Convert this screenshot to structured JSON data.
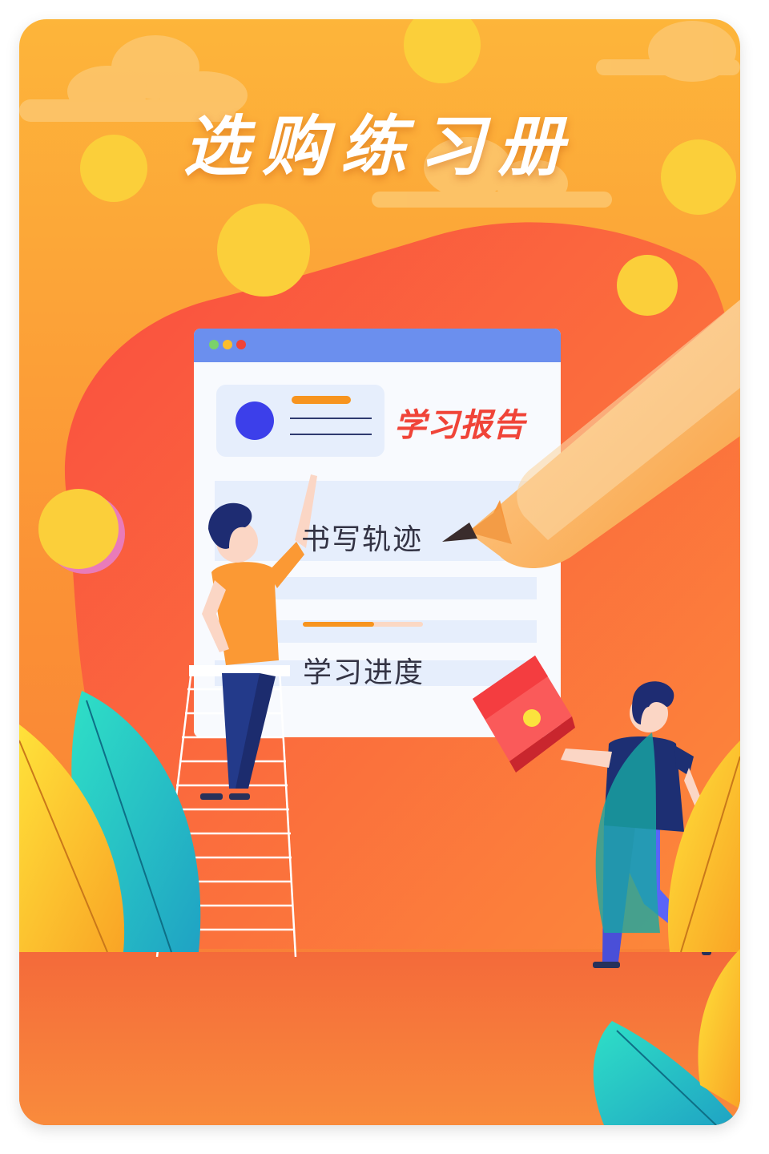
{
  "title": "选购练习册",
  "screen": {
    "report_label": "学习报告",
    "row1_text": "书写轨迹",
    "row2_text": "学习进度",
    "progress_fraction": 0.59
  },
  "colors": {
    "bg_top": "#fdb53a",
    "bg_bottom": "#f77a38",
    "blob": "#fb4d3f",
    "browser_header": "#6b8fee",
    "accent_red": "#f04438",
    "coin": "#fbcf3a"
  }
}
